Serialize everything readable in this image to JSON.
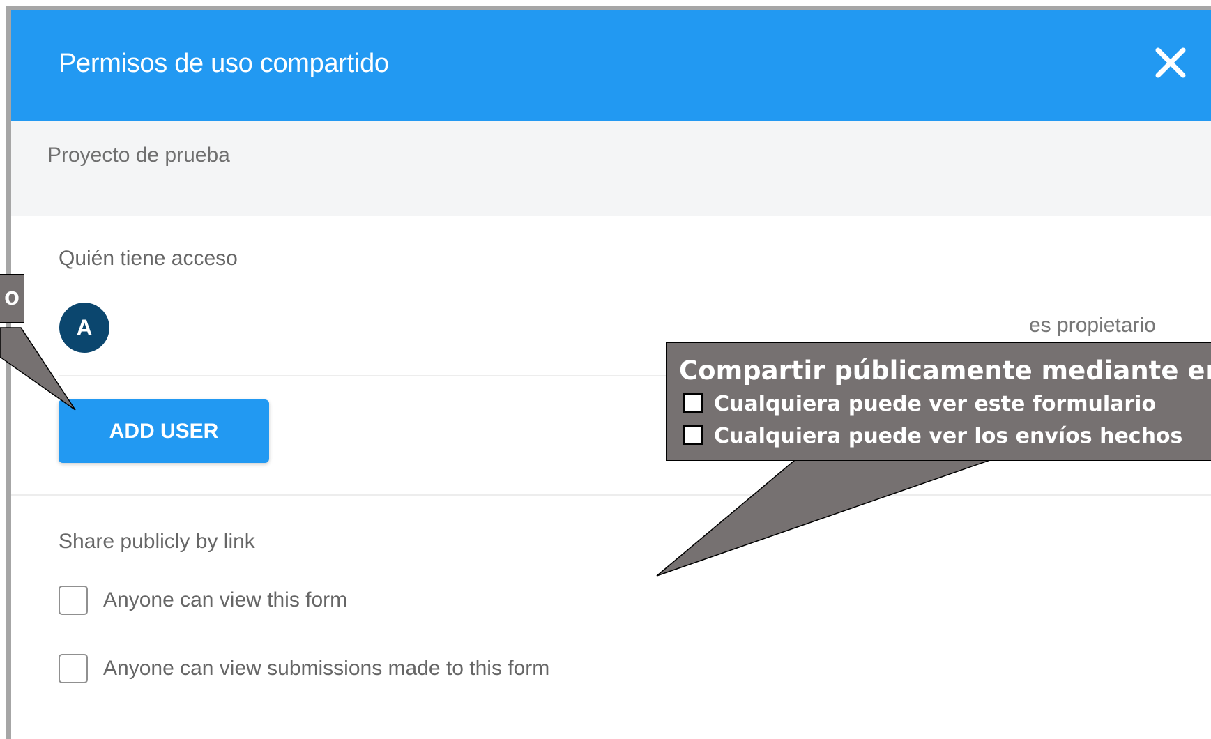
{
  "dialog": {
    "title": "Permisos de uso compartido",
    "close_icon": "close-icon",
    "project_name": "Proyecto de prueba"
  },
  "access": {
    "label": "Quién tiene acceso",
    "users": [
      {
        "avatar_letter": "A",
        "role": "es propietario"
      }
    ],
    "add_user_label": "ADD USER"
  },
  "share": {
    "label": "Share publicly by link",
    "options": [
      {
        "label": "Anyone can view this form",
        "checked": false
      },
      {
        "label": "Anyone can view submissions made to this form",
        "checked": false
      }
    ]
  },
  "callouts": {
    "left_text": "o",
    "right": {
      "title": "Compartir públicamente mediante enl",
      "items": [
        "Cualquiera puede ver este formulario",
        "Cualquiera puede ver los envíos hechos"
      ]
    }
  },
  "colors": {
    "header_blue": "#2299f2",
    "avatar_navy": "#0b466e",
    "callout_gray": "#767171"
  }
}
